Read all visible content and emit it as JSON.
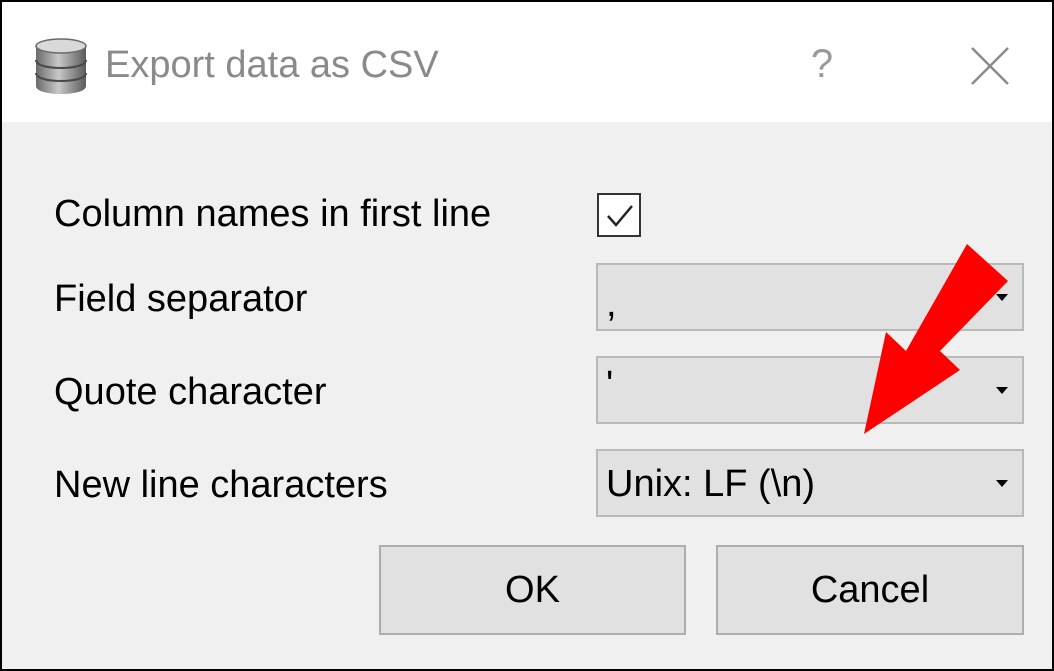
{
  "window": {
    "title": "Export data as CSV",
    "help_label": "?",
    "app_icon": "database-icon",
    "close_icon": "close-icon"
  },
  "options": {
    "column_names": {
      "label": "Column names in first line",
      "checked": true
    },
    "field_separator": {
      "label": "Field separator",
      "value": ","
    },
    "quote_character": {
      "label": "Quote character",
      "value": "'"
    },
    "new_line": {
      "label": "New line characters",
      "value": "Unix: LF (\\n)"
    }
  },
  "buttons": {
    "ok_label": "OK",
    "cancel_label": "Cancel"
  },
  "annotation": {
    "arrow_icon": "red-arrow-icon",
    "arrow_color": "#ff0000"
  }
}
